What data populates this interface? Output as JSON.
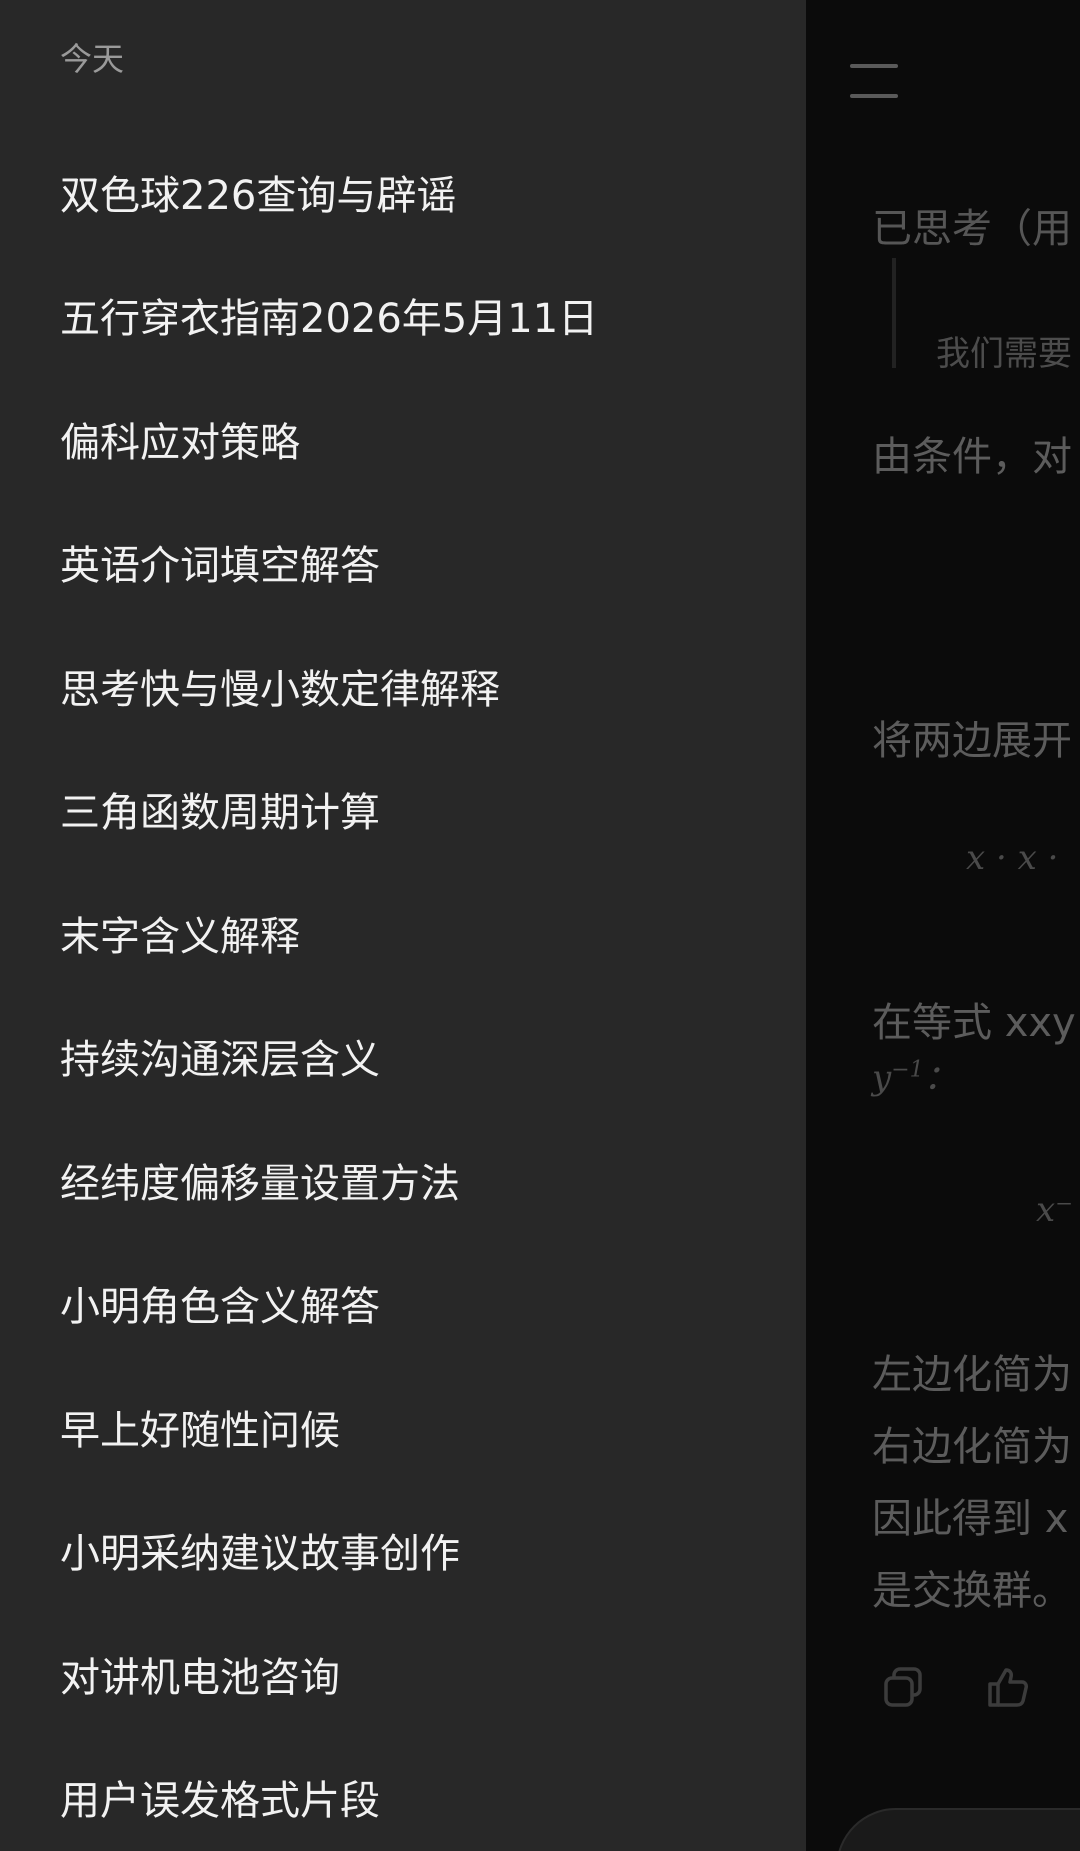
{
  "drawer": {
    "section_header": "今天",
    "items": [
      {
        "label": "双色球226查询与辟谣"
      },
      {
        "label": "五行穿衣指南2026年5月11日"
      },
      {
        "label": "偏科应对策略"
      },
      {
        "label": "英语介词填空解答"
      },
      {
        "label": "思考快与慢小数定律解释"
      },
      {
        "label": "三角函数周期计算"
      },
      {
        "label": "末字含义解释"
      },
      {
        "label": "持续沟通深层含义"
      },
      {
        "label": "经纬度偏移量设置方法"
      },
      {
        "label": "小明角色含义解答"
      },
      {
        "label": "早上好随性问候"
      },
      {
        "label": "小明采纳建议故事创作"
      },
      {
        "label": "对讲机电池咨询"
      },
      {
        "label": "用户误发格式片段"
      }
    ]
  },
  "chat": {
    "thought_label": "已思考（用",
    "quote_text": "我们需要",
    "line1": "由条件，对",
    "line2": "将两边展开",
    "math1": "x · x ·",
    "line3": "在等式 xxy",
    "math2_base": "y",
    "math2_exp": "−1",
    "math2_suffix": "：",
    "math3": "x⁻",
    "line4": "左边化简为",
    "line5": "右边化简为",
    "line6": "因此得到 x",
    "line7": "是交换群。"
  },
  "icons": {
    "menu": "menu-icon",
    "copy": "copy-icon",
    "like": "thumbs-up-icon"
  },
  "colors": {
    "drawer_bg": "#282828",
    "main_bg": "#0b0b0b",
    "item_text": "#f2f2f2",
    "header_text": "#9a9a9a"
  }
}
